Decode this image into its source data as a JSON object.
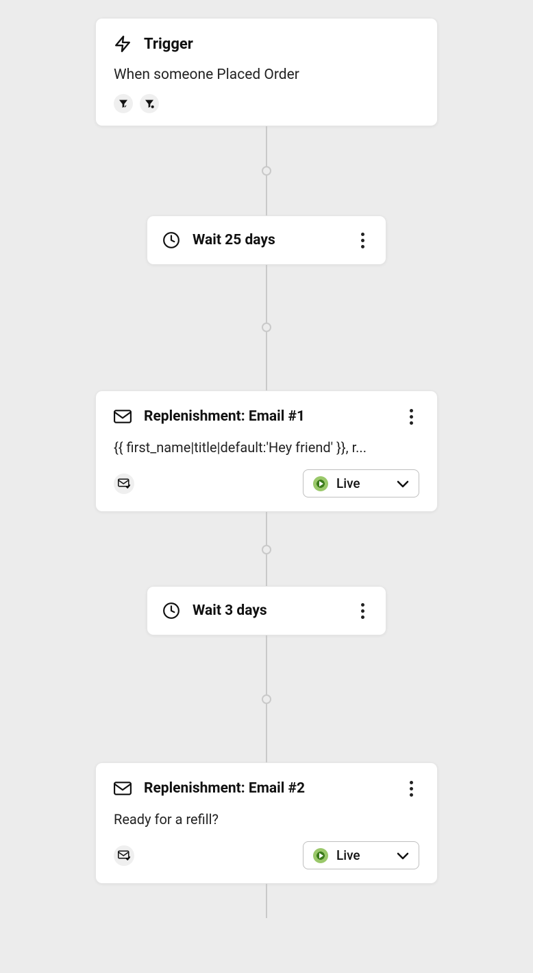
{
  "trigger": {
    "title": "Trigger",
    "description": "When someone Placed Order"
  },
  "steps": [
    {
      "type": "wait",
      "label": "Wait 25 days"
    },
    {
      "type": "email",
      "title": "Replenishment: Email #1",
      "subject": "{{ first_name|title|default:'Hey friend' }}, r...",
      "status": "Live"
    },
    {
      "type": "wait",
      "label": "Wait 3 days"
    },
    {
      "type": "email",
      "title": "Replenishment: Email #2",
      "subject": "Ready for a refill?",
      "status": "Live"
    }
  ]
}
